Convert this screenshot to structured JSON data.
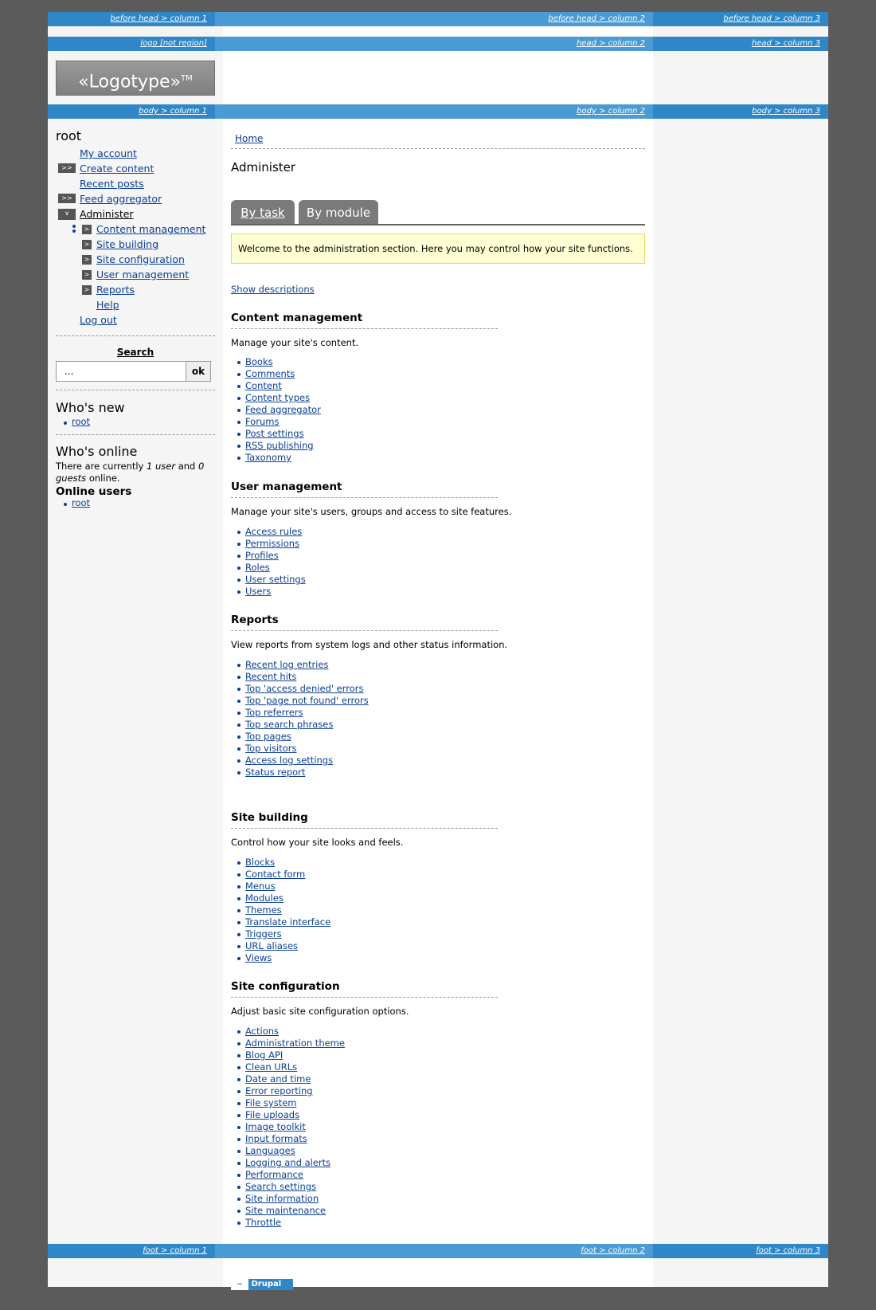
{
  "bars": {
    "before_head": [
      "before head > column 1",
      "before head > column 2",
      "before head > column 3"
    ],
    "head": [
      "logo [not region]",
      "head > column 2",
      "head > column 3"
    ],
    "body": [
      "body > column 1",
      "body > column 2",
      "body > column 3"
    ],
    "foot": [
      "foot > column 1",
      "foot > column 2",
      "foot > column 3"
    ]
  },
  "logo": {
    "text": "«Logotype»",
    "mark": "TM"
  },
  "sidebar": {
    "user": "root",
    "menu": [
      {
        "label": "My account"
      },
      {
        "label": "Create content"
      },
      {
        "label": "Recent posts"
      },
      {
        "label": "Feed aggregator"
      },
      {
        "label": "Administer"
      },
      {
        "label": "Content management"
      },
      {
        "label": "Site building"
      },
      {
        "label": "Site configuration"
      },
      {
        "label": "User management"
      },
      {
        "label": "Reports"
      },
      {
        "label": "Help"
      },
      {
        "label": "Log out"
      }
    ],
    "search": {
      "label": "Search",
      "value": "...",
      "button": "ok"
    },
    "whos_new": {
      "title": "Who's new",
      "users": [
        "root"
      ]
    },
    "whos_online": {
      "title": "Who's online",
      "text1": "There are currently",
      "count_users": "1 user",
      "and": "and",
      "count_guests": "0",
      "guests": "guests",
      "online": "online.",
      "subtitle": "Online users",
      "users": [
        "root"
      ]
    }
  },
  "main": {
    "breadcrumb": "Home",
    "title": "Administer",
    "tabs": [
      "By task",
      "By module"
    ],
    "welcome": "Welcome to the administration section. Here you may control how your site functions.",
    "show_descriptions": "Show descriptions",
    "sections": [
      {
        "title": "Content management",
        "description": "Manage your site's content.",
        "links": [
          "Books",
          "Comments",
          "Content",
          "Content types",
          "Feed aggregator",
          "Forums",
          "Post settings",
          "RSS publishing",
          "Taxonomy"
        ]
      },
      {
        "title": "User management",
        "description": "Manage your site's users, groups and access to site features.",
        "links": [
          "Access rules",
          "Permissions",
          "Profiles",
          "Roles",
          "User settings",
          "Users"
        ]
      },
      {
        "title": "Reports",
        "description": "View reports from system logs and other status information.",
        "links": [
          "Recent log entries",
          "Recent hits",
          "Top 'access denied' errors",
          "Top 'page not found' errors",
          "Top referrers",
          "Top search phrases",
          "Top pages",
          "Top visitors",
          "Access log settings",
          "Status report"
        ]
      },
      {
        "title": "Site building",
        "description": "Control how your site looks and feels.",
        "links": [
          "Blocks",
          "Contact form",
          "Menus",
          "Modules",
          "Themes",
          "Translate interface",
          "Triggers",
          "URL aliases",
          "Views"
        ]
      },
      {
        "title": "Site configuration",
        "description": "Adjust basic site configuration options.",
        "links": [
          "Actions",
          "Administration theme",
          "Blog API",
          "Clean URLs",
          "Date and time",
          "Error reporting",
          "File system",
          "File uploads",
          "Image toolkit",
          "Input formats",
          "Languages",
          "Logging and alerts",
          "Performance",
          "Search settings",
          "Site information",
          "Site maintenance",
          "Throttle"
        ]
      }
    ]
  },
  "footer": {
    "badge": "Drupal"
  }
}
